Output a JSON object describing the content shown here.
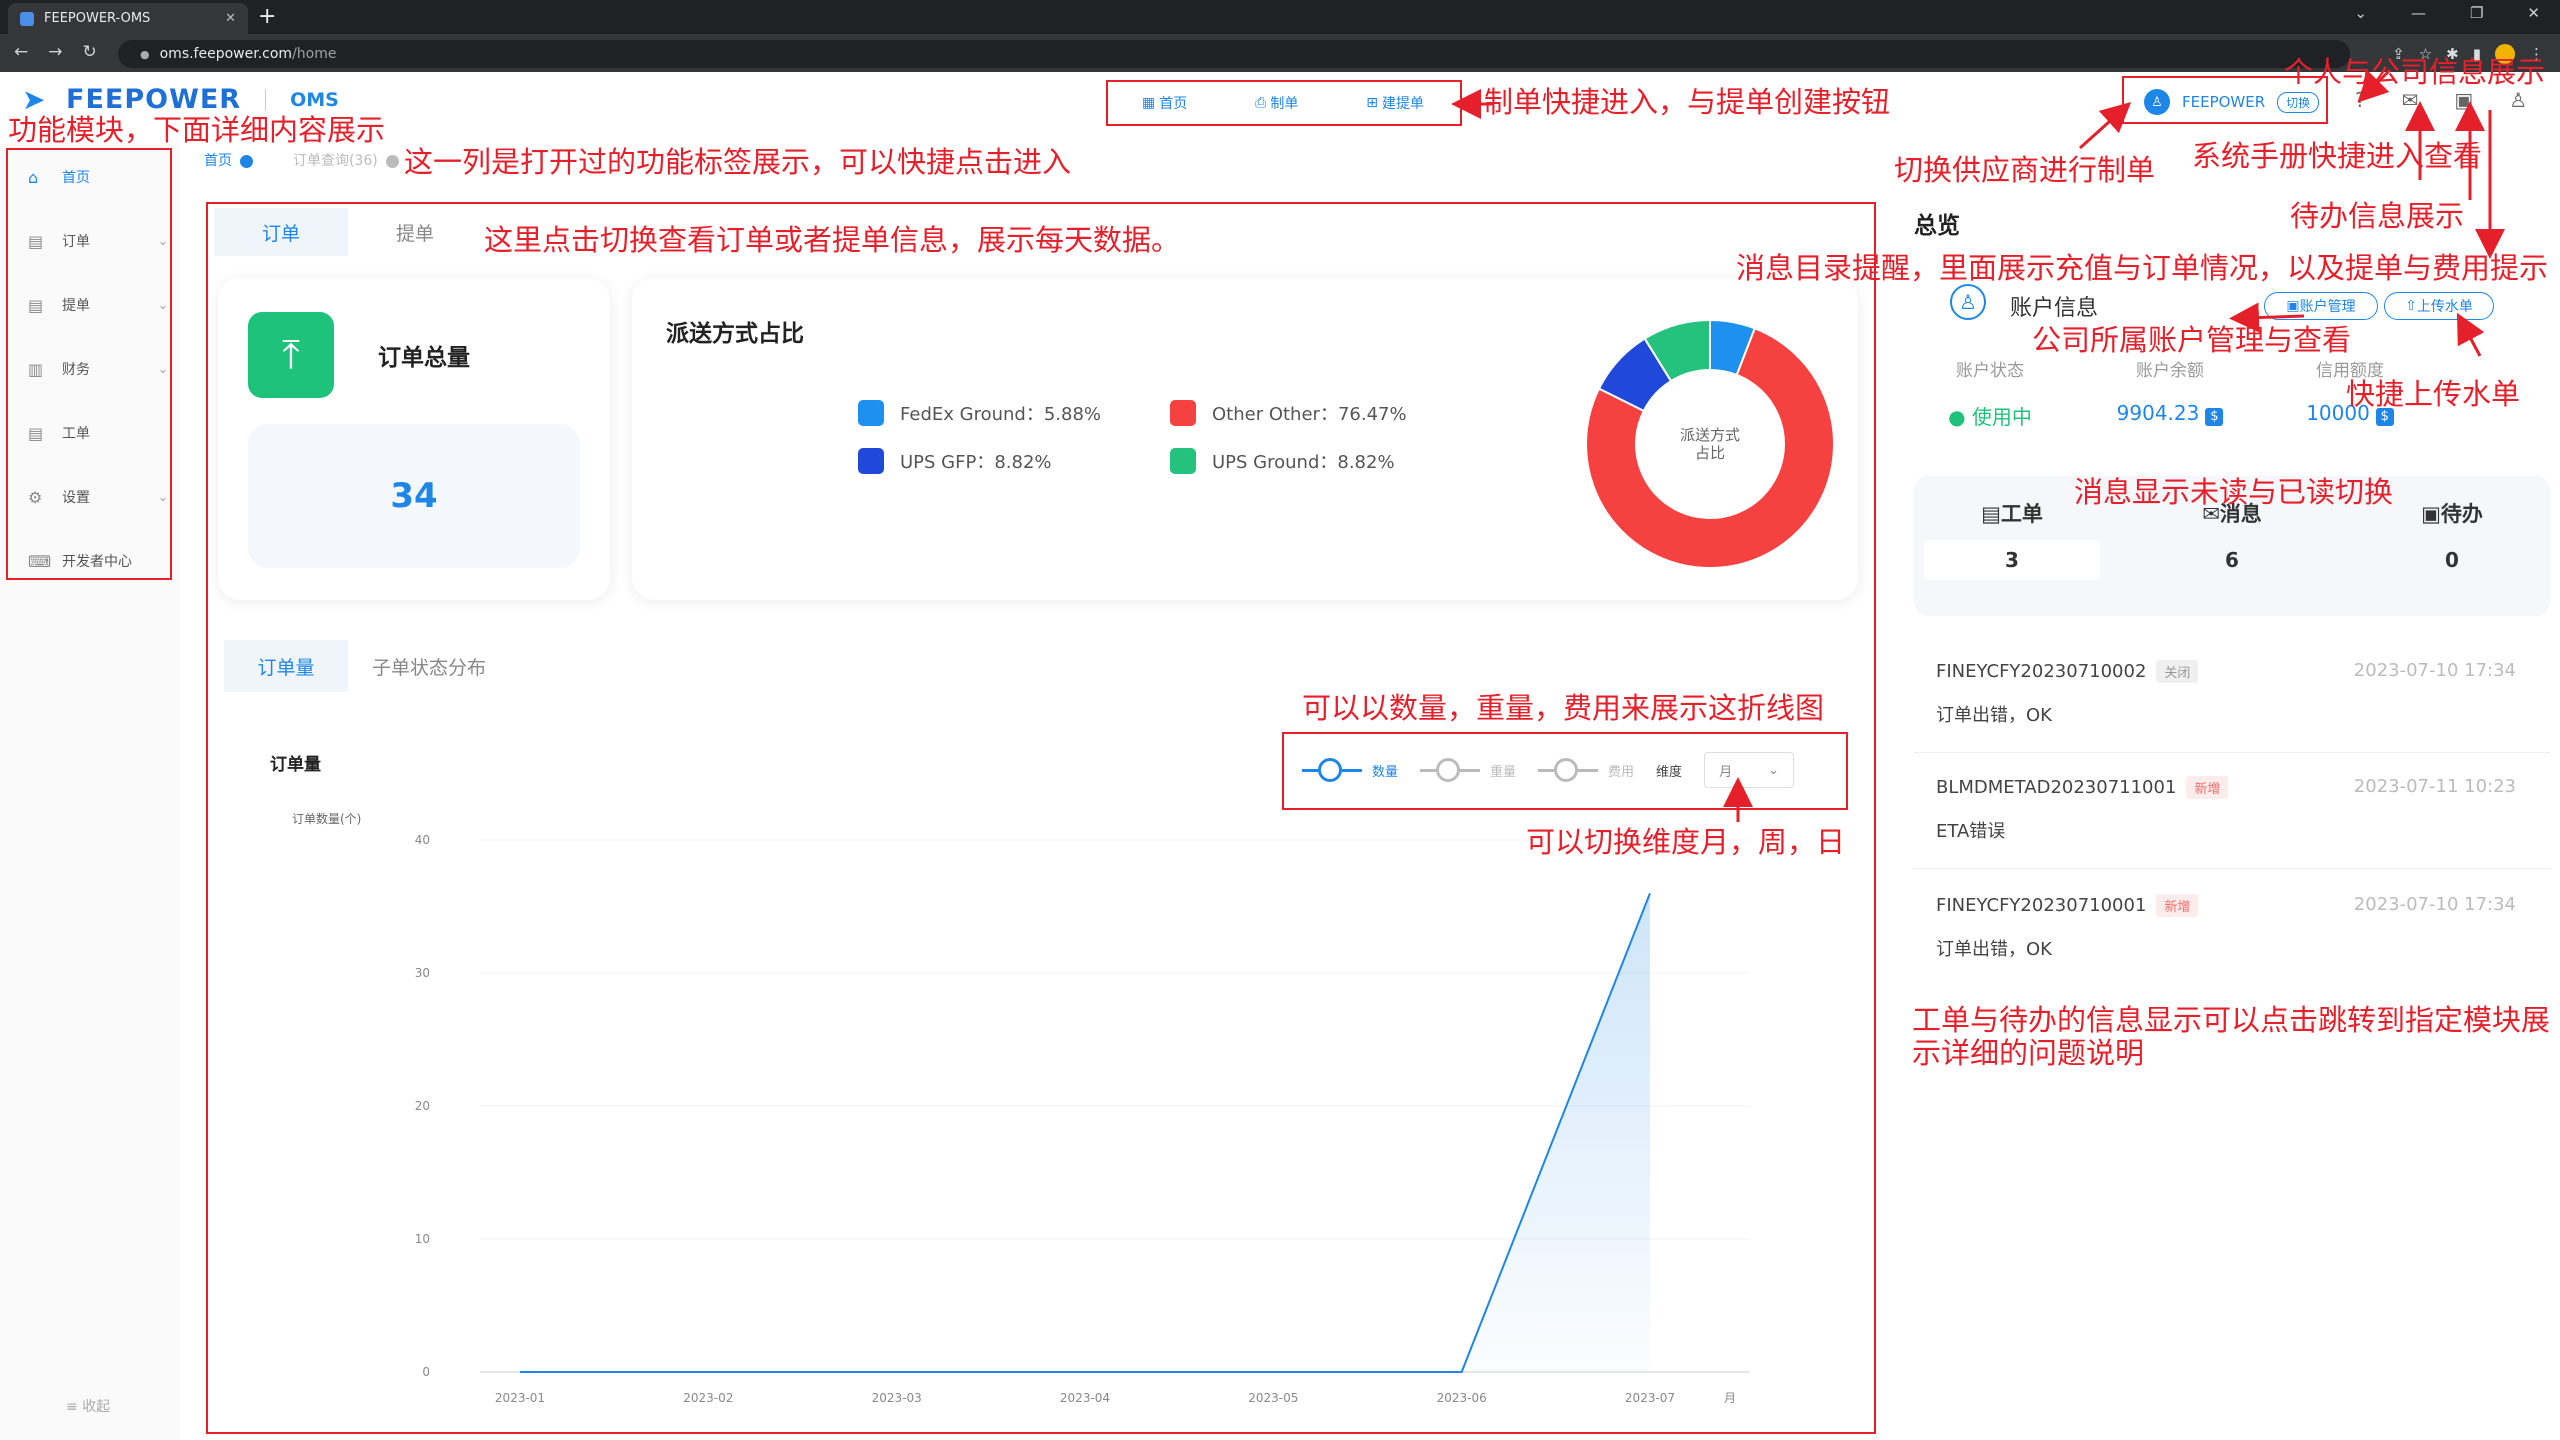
{
  "browser": {
    "tab_title": "FEEPOWER-OMS",
    "url_host": "oms.feepower.com",
    "url_path": "/home"
  },
  "header": {
    "logo_text": "FEEPOWER",
    "product": "OMS",
    "quick_nav": [
      "首页",
      "制单",
      "建提单"
    ],
    "supplier_name": "FEEPOWER",
    "supplier_switch": "切换"
  },
  "sidebar": {
    "items": [
      {
        "label": "首页",
        "icon": "home-icon"
      },
      {
        "label": "订单",
        "icon": "order-icon"
      },
      {
        "label": "提单",
        "icon": "bill-icon"
      },
      {
        "label": "财务",
        "icon": "finance-icon"
      },
      {
        "label": "工单",
        "icon": "ticket-icon"
      },
      {
        "label": "设置",
        "icon": "settings-icon"
      },
      {
        "label": "开发者中心",
        "icon": "code-icon"
      }
    ],
    "collapse": "收起"
  },
  "open_tabs": [
    "首页",
    "订单查询(36)"
  ],
  "main": {
    "tabs": [
      "订单",
      "提单"
    ],
    "total_title": "订单总量",
    "total_value": "34",
    "dist_title": "派送方式占比",
    "donut_center": [
      "派送方式",
      "占比"
    ],
    "legend": [
      {
        "label": "FedEx Ground：5.88%",
        "color": "#1e90f0",
        "pct": 5.88
      },
      {
        "label": "Other Other：76.47%",
        "color": "#f5413f",
        "pct": 76.47
      },
      {
        "label": "UPS GFP：8.82%",
        "color": "#2149d9",
        "pct": 8.82
      },
      {
        "label": "UPS Ground：8.82%",
        "color": "#25c27d",
        "pct": 8.82
      }
    ],
    "subtabs": [
      "订单量",
      "子单状态分布"
    ],
    "chart_title": "订单量",
    "toggles": [
      "数量",
      "重量",
      "费用"
    ],
    "dim_label": "维度",
    "dim_value": "月"
  },
  "chart_data": {
    "type": "area",
    "title": "订单量",
    "ylabel": "订单数量(个)",
    "xlabel": "月",
    "categories": [
      "2023-01",
      "2023-02",
      "2023-03",
      "2023-04",
      "2023-05",
      "2023-06",
      "2023-07"
    ],
    "values": [
      0,
      0,
      0,
      0,
      0,
      0,
      36
    ],
    "ylim": [
      0,
      40
    ],
    "yticks": [
      0,
      10,
      20,
      30,
      40
    ],
    "color": "#1e86e6"
  },
  "right": {
    "title": "总览",
    "account_title": "账户信息",
    "btn_account": "账户管理",
    "btn_upload": "上传水单",
    "cols": [
      {
        "h": "账户状态",
        "v": "使用中"
      },
      {
        "h": "账户余额",
        "v": "9904.23"
      },
      {
        "h": "信用额度",
        "v": "10000"
      }
    ],
    "msg_tabs": [
      {
        "label": "工单",
        "count": "3"
      },
      {
        "label": "消息",
        "count": "6"
      },
      {
        "label": "待办",
        "count": "0"
      }
    ],
    "messages": [
      {
        "id": "FINEYCFY20230710002",
        "tag": "关闭",
        "time": "2023-07-10 17:34",
        "desc": "订单出错，OK"
      },
      {
        "id": "BLMDMETAD20230711001",
        "tag": "新增",
        "time": "2023-07-11 10:23",
        "desc": "ETA错误"
      },
      {
        "id": "FINEYCFY20230710001",
        "tag": "新增",
        "time": "2023-07-10 17:34",
        "desc": "订单出错，OK"
      }
    ]
  },
  "annotations": {
    "sidebar": "功能模块，下面详细内容展示",
    "tabs": "这一列是打开过的功能标签展示，可以快捷点击进入",
    "quicknav": "制单快捷进入，与提单创建按钮",
    "supplier": "切换供应商进行制单",
    "manual": "系统手册快捷进入查看",
    "profile": "个人与公司信息展示",
    "todo": "待办信息展示",
    "notify": "消息目录提醒，里面展示充值与订单情况，以及提单与费用提示",
    "account": "公司所属账户管理与查看",
    "upload": "快捷上传水单",
    "switch_view": "这里点击切换查看订单或者提单信息，展示每天数据。",
    "read": "消息显示未读与已读切换",
    "metric": "可以以数量，重量，费用来展示这折线图",
    "dimension": "可以切换维度月，周，日",
    "workorder": "工单与待办的信息显示可以点击跳转到指定模块展示详细的问题说明"
  }
}
